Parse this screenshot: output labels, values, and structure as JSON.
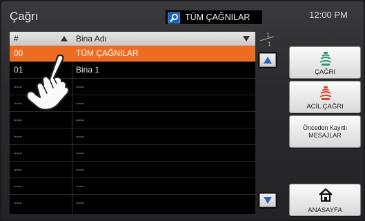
{
  "app": {
    "title": "Çağrı",
    "clock": "12:00 PM"
  },
  "search": {
    "label": "TÜM ÇAĞNILAR"
  },
  "list": {
    "header": {
      "number": "#",
      "name": "Bina Adı"
    },
    "page_current": "1",
    "page_total": "1",
    "rows": [
      {
        "number": "00",
        "name": "TÜM ÇAĞNILAR",
        "state": "selected"
      },
      {
        "number": "01",
        "name": "Bina 1",
        "state": "normal"
      },
      {
        "number": "---",
        "name": "---",
        "state": "empty"
      },
      {
        "number": "---",
        "name": "---",
        "state": "empty"
      },
      {
        "number": "---",
        "name": "---",
        "state": "empty"
      },
      {
        "number": "---",
        "name": "---",
        "state": "empty"
      },
      {
        "number": "---",
        "name": "---",
        "state": "empty"
      },
      {
        "number": "---",
        "name": "---",
        "state": "empty"
      },
      {
        "number": "---",
        "name": "---",
        "state": "empty"
      },
      {
        "number": "---",
        "name": "---",
        "state": "empty"
      }
    ]
  },
  "side_buttons": {
    "call": "ÇAĞRI",
    "emergency_call": "ACİL ÇAĞRI",
    "history_line1": "Önceden Kayıtlı",
    "history_line2": "MESAJLAR",
    "home": "ANASAYFA"
  },
  "icons": {
    "search": "magnifier-icon",
    "call": "call-icon",
    "emergency": "emergency-call-icon",
    "home": "home-icon",
    "scroll_up": "arrow-up-icon",
    "scroll_down": "arrow-down-icon",
    "hand": "pointing-hand-icon"
  },
  "colors": {
    "selected_row": "#ee6c21",
    "accent_blue": "#2a63c2",
    "call_green": "#2e9a6b",
    "emergency_red": "#d9452b"
  }
}
